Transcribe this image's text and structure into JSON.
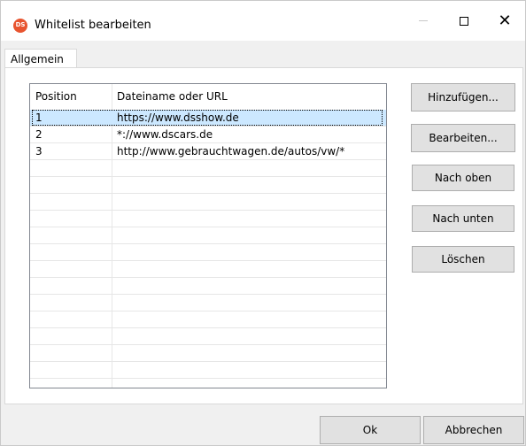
{
  "window": {
    "title": "Whitelist bearbeiten",
    "icon_text": "DS"
  },
  "tabs": [
    {
      "label": "Allgemein"
    }
  ],
  "list": {
    "columns": [
      "Position",
      "Dateiname oder URL"
    ],
    "rows": [
      {
        "position": "1",
        "url": "https://www.dsshow.de",
        "selected": true
      },
      {
        "position": "2",
        "url": "*://www.dscars.de",
        "selected": false
      },
      {
        "position": "3",
        "url": "http://www.gebrauchtwagen.de/autos/vw/*",
        "selected": false
      }
    ]
  },
  "side_buttons": {
    "add": "Hinzufügen...",
    "edit": "Bearbeiten...",
    "up": "Nach oben",
    "down": "Nach unten",
    "delete": "Löschen"
  },
  "footer": {
    "ok": "Ok",
    "cancel": "Abbrechen"
  },
  "colors": {
    "selection": "#cce8ff",
    "icon": "#e8542f"
  }
}
